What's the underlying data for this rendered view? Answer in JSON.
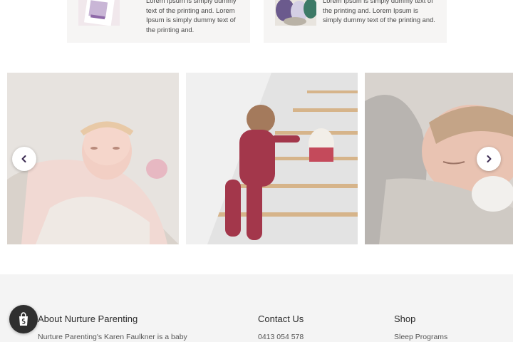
{
  "cards": [
    {
      "text": "Lorem Ipsum is simply dummy text of the printing and. Lorem Ipsum is simply dummy text of the printing and."
    },
    {
      "text": "Lorem Ipsum is simply dummy text of the printing and. Lorem Ipsum is simply dummy text of the printing and."
    }
  ],
  "icons": {
    "prev": "chevron-left-icon",
    "next": "chevron-right-icon",
    "shop": "shopify-bag-icon"
  },
  "footer": {
    "about": {
      "heading": "About Nurture Parenting",
      "text": "Nurture Parenting's Karen Faulkner is a baby"
    },
    "contact": {
      "heading": "Contact Us",
      "phone": "0413 054 578"
    },
    "shop": {
      "heading": "Shop",
      "link": "Sleep Programs"
    }
  },
  "colors": {
    "footer_bg": "#f4f4f4",
    "card_bg": "#f6f5f4",
    "arrow_icon": "#3b2a52"
  }
}
